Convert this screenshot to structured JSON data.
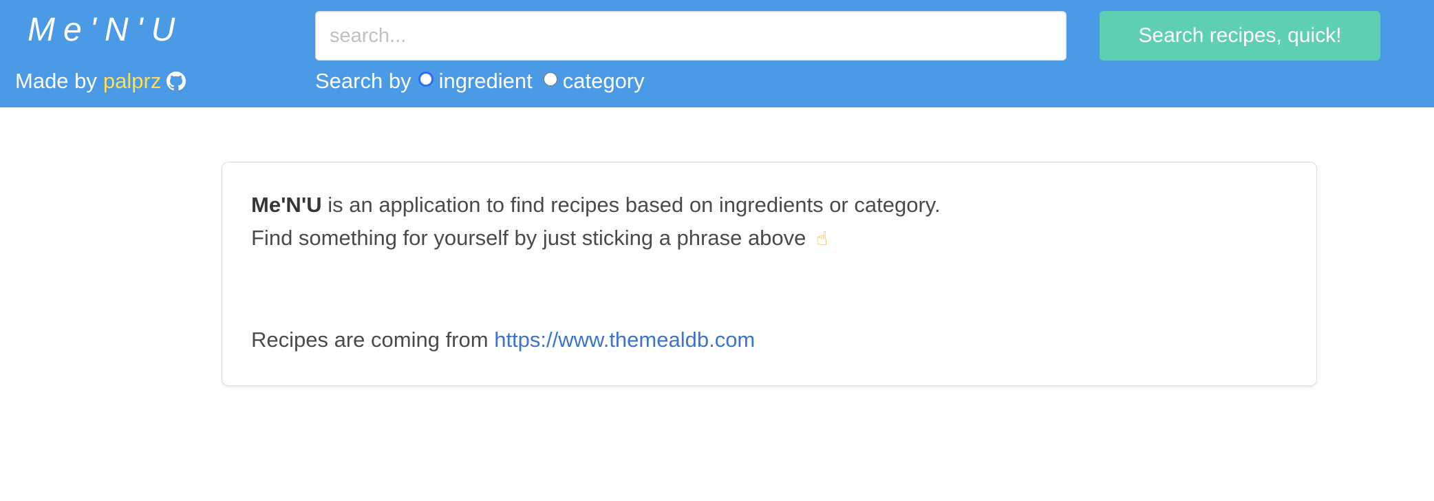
{
  "header": {
    "brand": "Me'N'U",
    "made_by_label": "Made by",
    "author_name": "palprz",
    "github_icon": "github-icon",
    "search": {
      "placeholder": "search...",
      "value": ""
    },
    "search_button_label": "Search recipes, quick!",
    "search_by": {
      "label": "Search by",
      "options": [
        {
          "label": "ingredient",
          "selected": false,
          "focused": true
        },
        {
          "label": "category",
          "selected": false,
          "focused": false
        }
      ]
    }
  },
  "intro_card": {
    "app_name": "Me'N'U",
    "description": "is an application to find recipes based on ingredients or category.",
    "instruction": "Find something for yourself by just sticking a phrase above",
    "instruction_icon": "pointing-up-hand-icon",
    "source_prefix": "Recipes are coming from",
    "source_link": "https://www.themealdb.com"
  },
  "colors": {
    "navbar_bg": "#4a9ae6",
    "button_bg": "#5fcfb1",
    "author_link": "#ffdd57",
    "body_link": "#3b73d4"
  }
}
